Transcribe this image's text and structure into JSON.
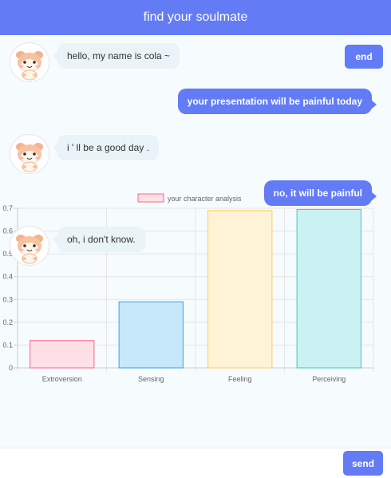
{
  "header": {
    "title": "find your soulmate"
  },
  "controls": {
    "end_label": "end",
    "send_label": "send"
  },
  "composer": {
    "value": "",
    "placeholder": ""
  },
  "messages": [
    {
      "sender": "bot",
      "text": "hello, my name is cola ~"
    },
    {
      "sender": "user",
      "text": "your presentation will be painful today"
    },
    {
      "sender": "bot",
      "text": "i ' ll be a good day ."
    },
    {
      "sender": "user",
      "text": "no, it will be painful"
    },
    {
      "sender": "bot",
      "text": "oh, i don't know."
    }
  ],
  "colors": {
    "accent": "#637cf5",
    "bot_bubble": "#e9f3f8",
    "background": "#f6fbfd"
  },
  "icons": {
    "avatar": "cat-avatar-icon"
  },
  "chart_data": {
    "type": "bar",
    "title": "",
    "legend": {
      "label": "your character analysis",
      "position": "top"
    },
    "categories": [
      "Extroversion",
      "Sensing",
      "Feeling",
      "Perceiving"
    ],
    "values": [
      0.12,
      0.29,
      0.69,
      0.695
    ],
    "yticks": [
      "0",
      "0.1",
      "0.2",
      "0.3",
      "0.4",
      "0.5",
      "0.6",
      "0.7"
    ],
    "ylim": [
      0,
      0.7
    ],
    "grid": true,
    "bar_fill": [
      "#ffe0e6",
      "#c7e7fa",
      "#fff3d6",
      "#cbf2f2"
    ],
    "bar_stroke": [
      "#ff6384",
      "#36a2eb",
      "#ffcd56",
      "#4bc0c0"
    ]
  }
}
